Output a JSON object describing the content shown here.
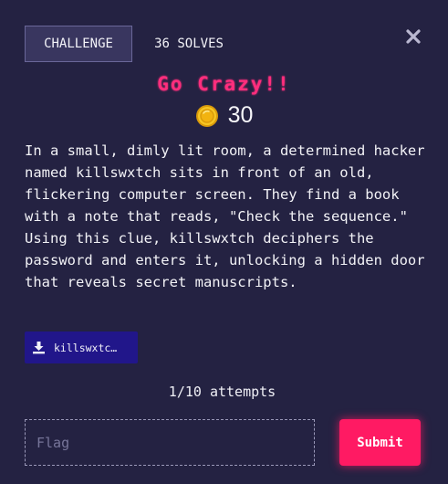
{
  "tabs": {
    "challenge_label": "CHALLENGE",
    "solves_label": "36 SOLVES"
  },
  "challenge": {
    "title": "Go Crazy!!",
    "points": "30",
    "description": "In a small, dimly lit room, a determined hacker named killswxtch sits in front of an old, flickering computer screen. They find a book with a note that reads, \"Check the sequence.\" Using this clue, killswxtch deciphers the password and enters it, unlocking a hidden door that reveals secret manuscripts."
  },
  "file": {
    "name": "killswxtc…",
    "icon": "download-icon"
  },
  "attempts": {
    "text": "1/10 attempts"
  },
  "flag_form": {
    "placeholder": "Flag",
    "value": "",
    "submit_label": "Submit"
  },
  "colors": {
    "background": "#242242",
    "title": "#ff2e7d",
    "submit": "#ff1a63",
    "file_button": "#21168a",
    "tab_active": "#39365f"
  },
  "icons": {
    "close": "close-icon",
    "coin": "coin-icon",
    "download": "download-icon"
  }
}
